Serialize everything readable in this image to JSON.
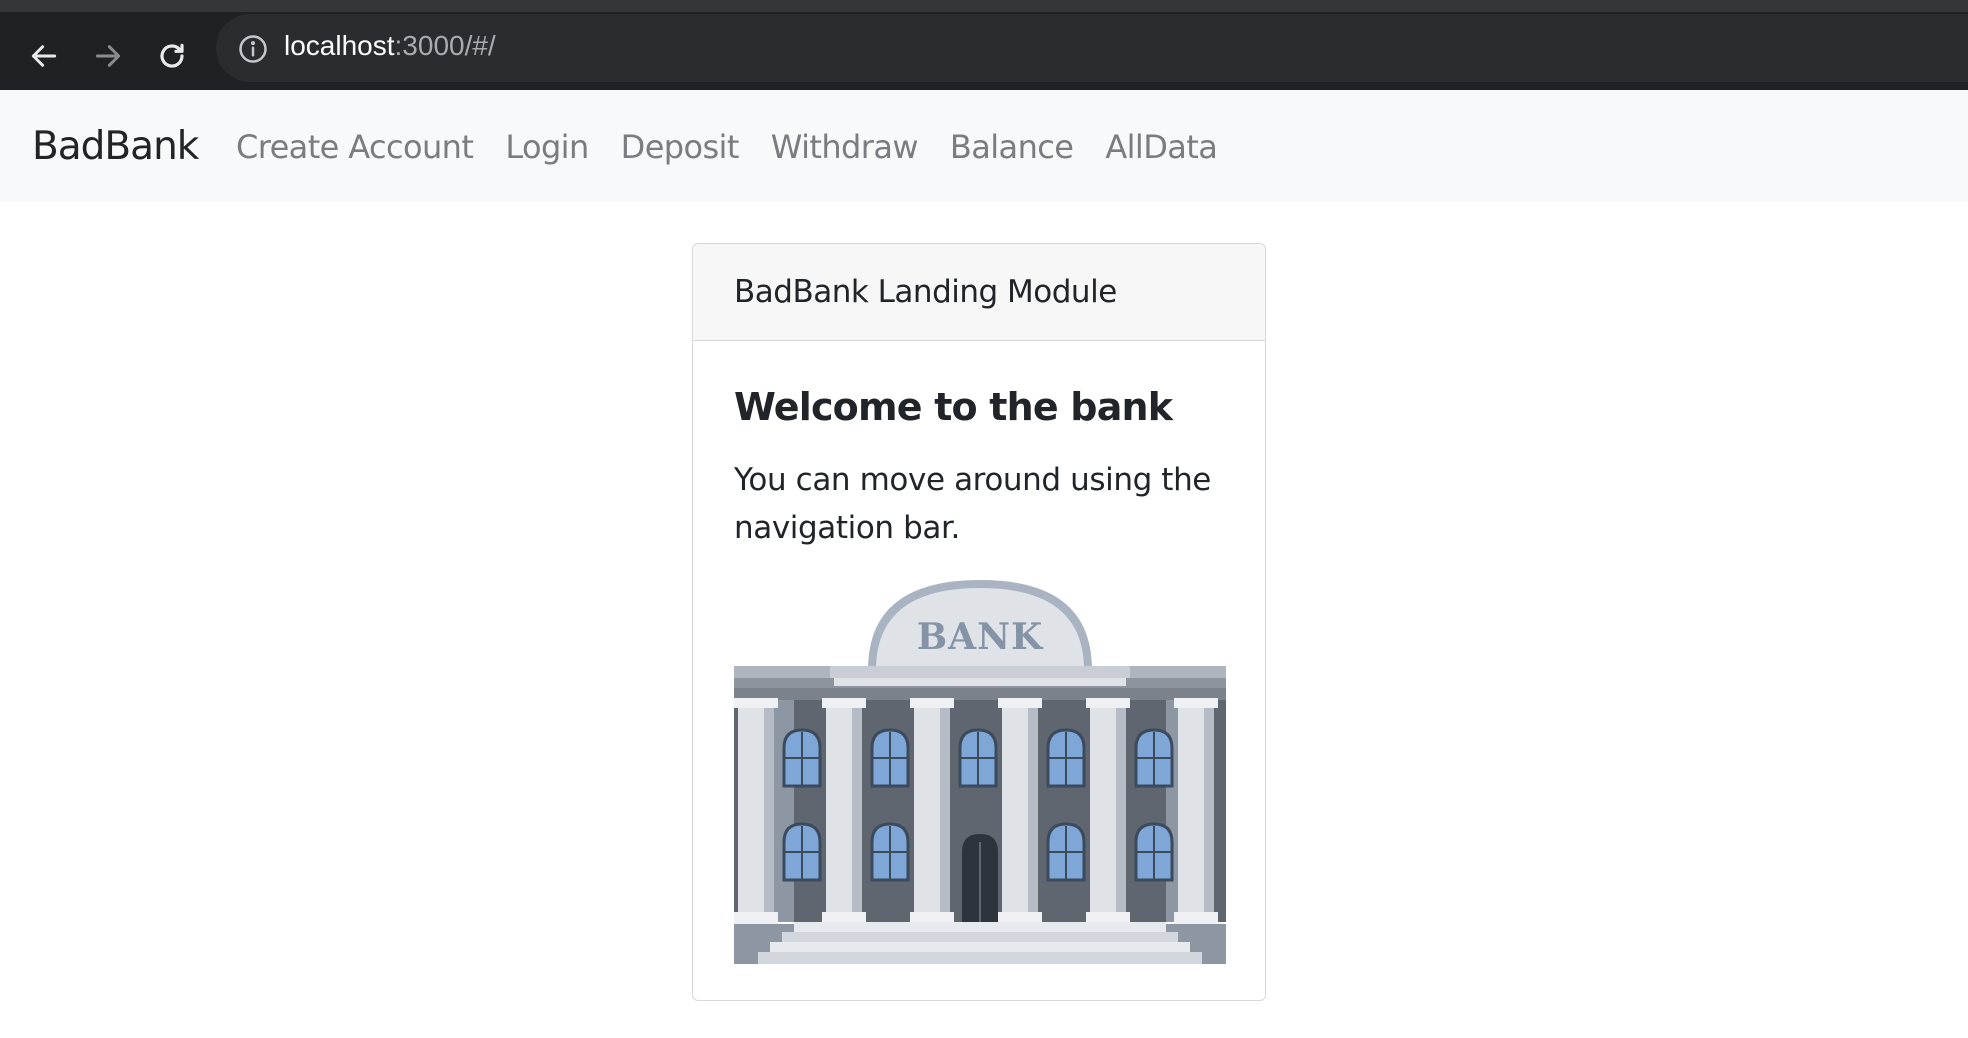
{
  "browser": {
    "url_host": "localhost",
    "url_rest": ":3000/#/"
  },
  "navbar": {
    "brand": "BadBank",
    "links": [
      "Create Account",
      "Login",
      "Deposit",
      "Withdraw",
      "Balance",
      "AllData"
    ]
  },
  "card": {
    "header": "BadBank Landing Module",
    "title": "Welcome to the bank",
    "text": "You can move around using the navigation bar.",
    "image_sign": "BANK"
  }
}
